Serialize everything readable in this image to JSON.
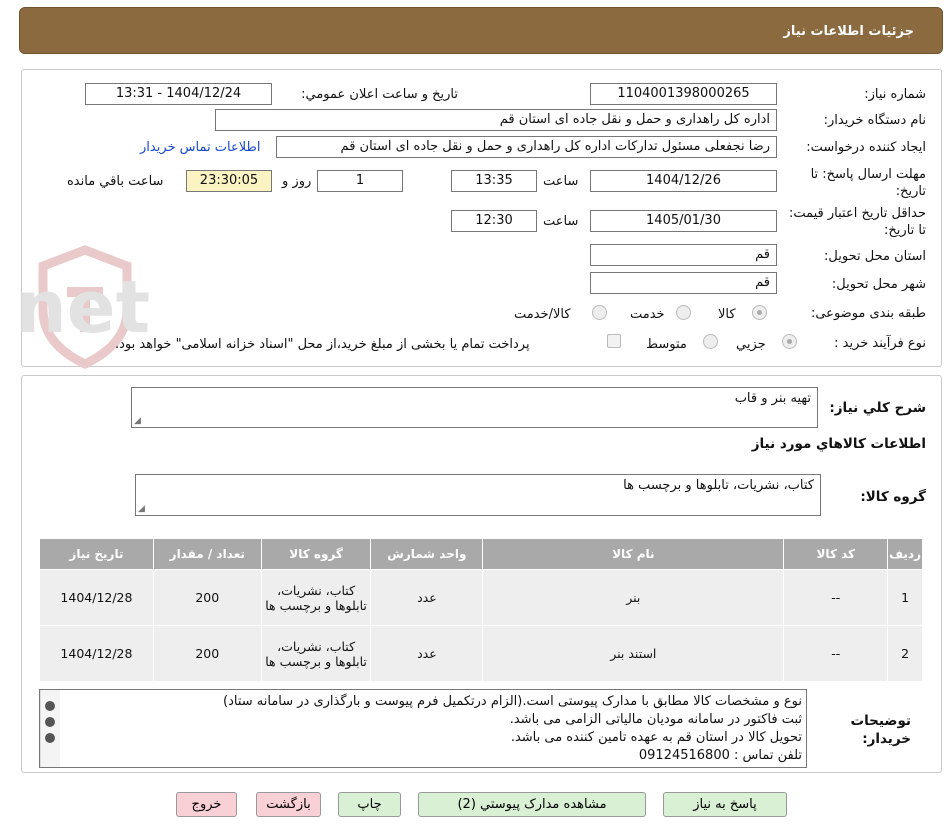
{
  "header": {
    "title": "جزئیات اطلاعات نیاز"
  },
  "form": {
    "need_number_label": "شماره نیاز:",
    "need_number": "1104001398000265",
    "announce_label": "تاریخ و ساعت اعلان عمومي:",
    "announce_value": "1404/12/24 - 13:31",
    "buyer_label": "نام دستگاه خريدار:",
    "buyer_value": "اداره کل راهداری و حمل و نقل جاده ای استان قم",
    "requester_label": "ايجاد کننده درخواست:",
    "requester_value": "رضا  نجفعلی مسئول تدارکات اداره کل راهداری و حمل و نقل جاده ای استان قم",
    "contact_link": "اطلاعات تماس خريدار",
    "reply_deadline_label": "مهلت ارسال پاسخ: تا تاريخ:",
    "reply_date": "1404/12/26",
    "time_label": "ساعت",
    "reply_time": "13:35",
    "days_value": "1",
    "days_label": "روز و",
    "remaining_value": "23:30:05",
    "remaining_label": "ساعت باقي مانده",
    "price_validity_label": "حداقل تاريخ اعتبار قيمت: تا تاريخ:",
    "price_date": "1405/01/30",
    "price_time": "12:30",
    "province_label": "استان محل تحويل:",
    "province_value": "قم",
    "city_label": "شهر محل تحويل:",
    "city_value": "قم",
    "category_label": "طبقه بندی موضوعی:",
    "category_options": [
      "کالا",
      "خدمت",
      "کالا/خدمت"
    ],
    "process_label": "نوع فرآيند خريد :",
    "process_options": [
      "جزيي",
      "متوسط"
    ],
    "payment_note": "پرداخت تمام يا بخشی از مبلغ خريد،از محل \"اسناد خزانه اسلامی\" خواهد بود."
  },
  "details": {
    "summary_label": "شرح کلي نياز:",
    "summary_value": "تهیه بنر و قاب",
    "goods_info_title": "اطلاعات کالاهاي مورد نياز",
    "goods_group_label": "گروه کالا:",
    "goods_group_value": "کتاب، نشريات، تابلوها و برچسب ها"
  },
  "table": {
    "headers": [
      "رديف",
      "کد کالا",
      "نام کالا",
      "واحد شمارش",
      "گروه کالا",
      "تعداد / مقدار",
      "تاريخ نياز"
    ],
    "rows": [
      [
        "1",
        "--",
        "بنر",
        "عدد",
        "کتاب، نشريات، تابلوها و برچسب ها",
        "200",
        "1404/12/28"
      ],
      [
        "2",
        "--",
        "استند بنر",
        "عدد",
        "کتاب، نشريات، تابلوها و برچسب ها",
        "200",
        "1404/12/28"
      ]
    ]
  },
  "notes": {
    "label": "توضيحات خريدار:",
    "lines": [
      "نوع و مشخصات کالا مطابق با مدارک پیوستی است.(الزام درتکمیل فرم پیوست و بارگذاری در سامانه ستاد)",
      "ثبت فاکتور در سامانه مودیان مالیاتی الزامی می باشد.",
      "تحویل کالا در استان قم به عهده تامین کننده می باشد.",
      "تلفن تماس : 09124516800"
    ]
  },
  "buttons": {
    "reply": "پاسخ به نياز",
    "attachments": "مشاهده مدارک پيوستي (2)",
    "print": "چاپ",
    "back": "بازگشت",
    "exit": "خروج"
  },
  "watermark": {
    "text": "AriaTender.net"
  },
  "colors": {
    "header_bg": "#8b6a3f",
    "table_header": "#a9a9a9",
    "button_green": "#d9f0d5",
    "button_red": "#f9d0d6",
    "link": "#1a49c9"
  }
}
